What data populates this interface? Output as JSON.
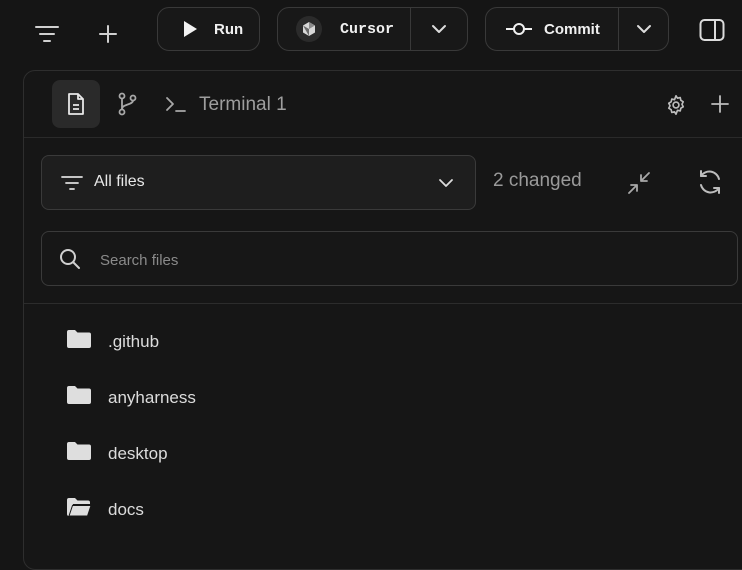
{
  "toolbar": {
    "run_label": "Run",
    "editor_label": "Cursor",
    "commit_label": "Commit"
  },
  "tabs": {
    "terminal_label": "Terminal 1"
  },
  "files_panel": {
    "filter_label": "All files",
    "changed_count": "2 changed",
    "search_placeholder": "Search files",
    "items": [
      {
        "name": ".github",
        "icon": "folder-icon"
      },
      {
        "name": "anyharness",
        "icon": "folder-icon"
      },
      {
        "name": "desktop",
        "icon": "folder-icon"
      },
      {
        "name": "docs",
        "icon": "folder-open-icon"
      }
    ]
  },
  "colors": {
    "background": "#151515",
    "panel": "#161616",
    "border": "#393939",
    "text": "#e6e6e6",
    "muted": "#9a9a9a"
  }
}
